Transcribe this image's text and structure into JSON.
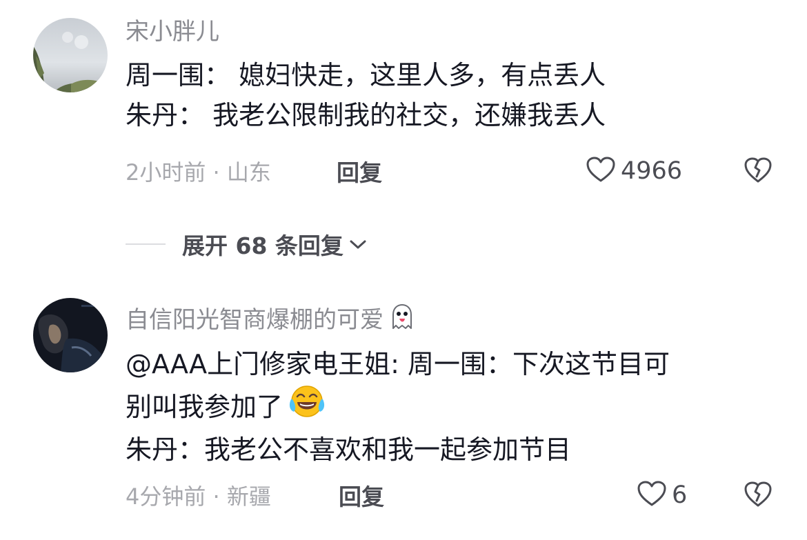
{
  "comments": [
    {
      "username": "宋小胖儿",
      "lines": [
        "周一围：  媳妇快走，这里人多，有点丢人",
        "朱丹：  我老公限制我的社交，还嫌我丢人"
      ],
      "time_location": "2小时前 · 山东",
      "reply_label": "回复",
      "likes": "4966",
      "avatar_icon": "sky-tree-avatar"
    },
    {
      "username": "自信阳光智商爆棚的可爱",
      "username_emoji": "ghost-emoji",
      "lines": [
        "@AAA上门修家电王姐: 周一围：下次这节目可",
        "别叫我参加了",
        "朱丹：我老公不喜欢和我一起参加节目"
      ],
      "line2_emoji": "laughing-tears-emoji",
      "time_location": "4分钟前 · 新疆",
      "reply_label": "回复",
      "likes": "6",
      "avatar_icon": "dark-photo-avatar"
    }
  ],
  "expand_replies": {
    "label": "展开 68 条回复"
  },
  "icons": {
    "like": "heart-outline-icon",
    "dislike": "broken-heart-icon",
    "expand": "chevron-down-icon"
  },
  "colors": {
    "text": "#161823",
    "username": "#8a8b91",
    "meta": "#a7a8ad",
    "action": "#4b4c53"
  }
}
